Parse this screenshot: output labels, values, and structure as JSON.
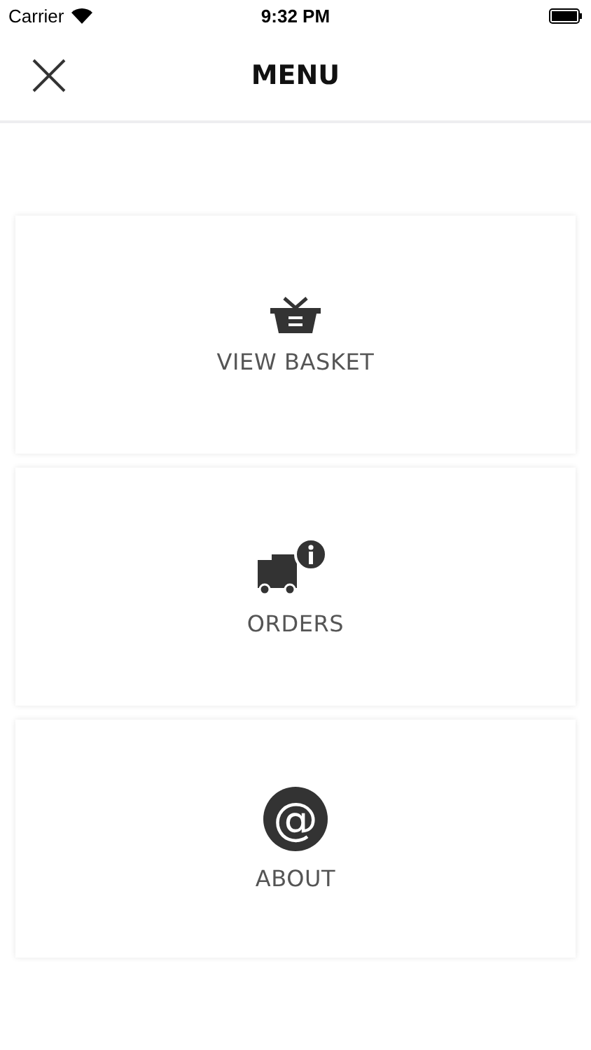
{
  "status_bar": {
    "carrier": "Carrier",
    "time": "9:32 PM"
  },
  "header": {
    "title": "MENU"
  },
  "menu": [
    {
      "kind": "basket",
      "label": "VIEW BASKET"
    },
    {
      "kind": "truck",
      "label": "ORDERS"
    },
    {
      "kind": "at",
      "icon_glyph": "@",
      "label": "ABOUT"
    }
  ]
}
